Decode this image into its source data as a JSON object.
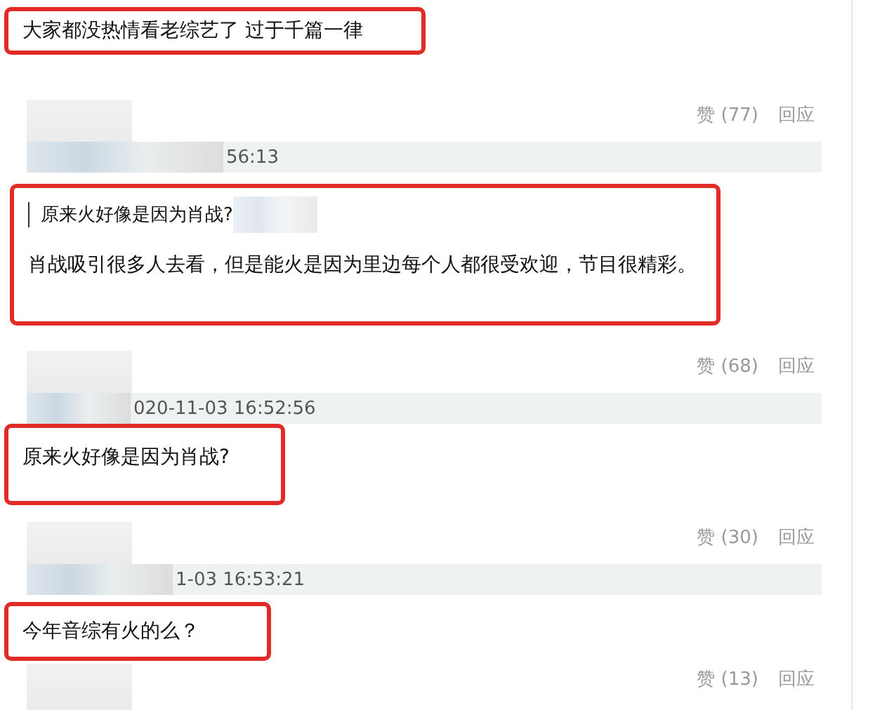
{
  "comments": [
    {
      "highlighted": true,
      "text": "大家都没热情看老综艺了 过于千篇一律",
      "likes": "赞 (77)",
      "reply": "回应",
      "timestamp": "56:13"
    },
    {
      "highlighted": true,
      "quote": "原来火好像是因为肖战?",
      "text": "肖战吸引很多人去看，但是能火是因为里边每个人都很受欢迎，节目很精彩。",
      "likes": "赞 (68)",
      "reply": "回应",
      "timestamp": "020-11-03 16:52:56"
    },
    {
      "highlighted": true,
      "text": "原来火好像是因为肖战?",
      "likes": "赞 (30)",
      "reply": "回应",
      "timestamp": "1-03 16:53:21"
    },
    {
      "highlighted": true,
      "text": "今年音综有火的么？",
      "likes": "赞 (13)",
      "reply": "回应"
    }
  ]
}
